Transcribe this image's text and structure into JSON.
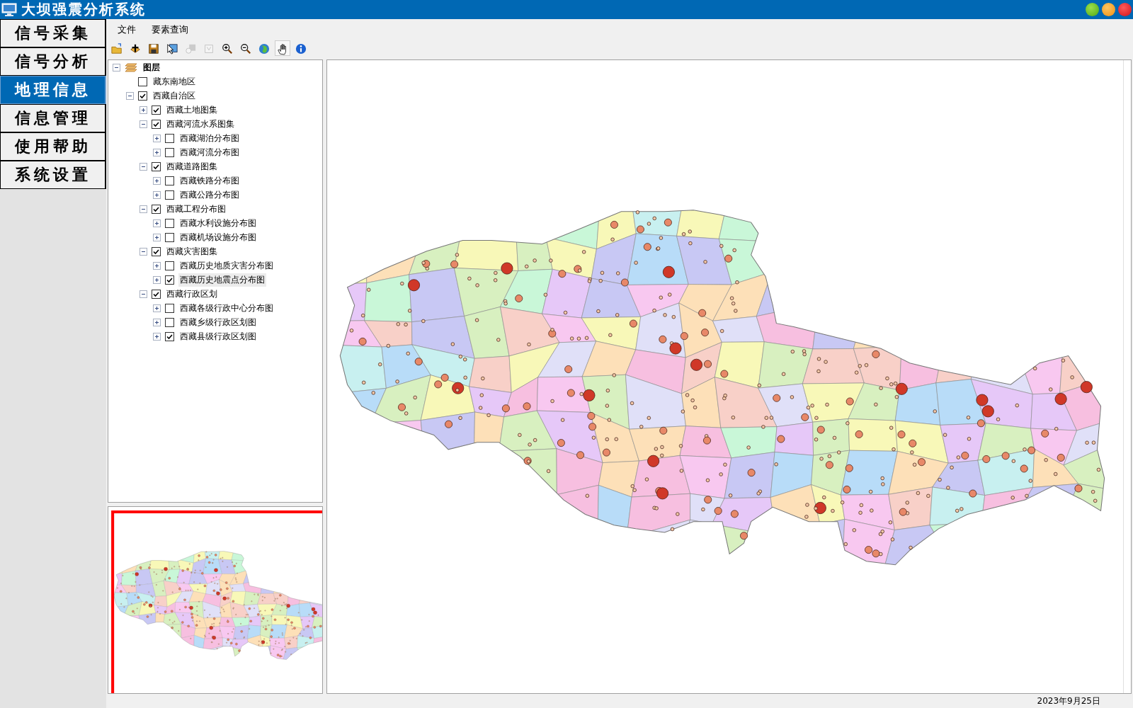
{
  "window": {
    "title": "大坝强震分析系统"
  },
  "nav": [
    {
      "label": "信号采集",
      "selected": false
    },
    {
      "label": "信号分析",
      "selected": false
    },
    {
      "label": "地理信息",
      "selected": true
    },
    {
      "label": "信息管理",
      "selected": false
    },
    {
      "label": "使用帮助",
      "selected": false
    },
    {
      "label": "系统设置",
      "selected": false
    }
  ],
  "menu": [
    "文件",
    "要素查询"
  ],
  "toolbar": [
    {
      "kind": "open",
      "disabled": false,
      "selected": false
    },
    {
      "kind": "add",
      "disabled": false,
      "selected": false
    },
    {
      "kind": "save",
      "disabled": false,
      "selected": false
    },
    {
      "kind": "select",
      "disabled": false,
      "selected": false
    },
    {
      "kind": "zoom-layer",
      "disabled": true,
      "selected": false
    },
    {
      "kind": "clear",
      "disabled": true,
      "selected": false
    },
    {
      "kind": "zoom-in",
      "disabled": false,
      "selected": false
    },
    {
      "kind": "zoom-out",
      "disabled": false,
      "selected": false
    },
    {
      "kind": "full-extent",
      "disabled": false,
      "selected": false
    },
    {
      "kind": "pan",
      "disabled": false,
      "selected": true
    },
    {
      "kind": "info",
      "disabled": false,
      "selected": false
    }
  ],
  "layers": {
    "label": "图层",
    "expanded": true,
    "children": [
      {
        "kind": "plain",
        "label": "藏东南地区",
        "checked": false,
        "selected": false
      },
      {
        "kind": "group",
        "label": "西藏自治区",
        "checked": true,
        "expanded": true,
        "selected": false,
        "children": [
          {
            "kind": "group",
            "label": "西藏土地图集",
            "checked": true,
            "expanded": false,
            "selected": false
          },
          {
            "kind": "group",
            "label": "西藏河流水系图集",
            "checked": true,
            "expanded": true,
            "selected": false,
            "children": [
              {
                "kind": "group",
                "label": "西藏湖泊分布图",
                "checked": false,
                "expanded": false,
                "selected": false
              },
              {
                "kind": "group",
                "label": "西藏河流分布图",
                "checked": false,
                "expanded": false,
                "selected": false
              }
            ]
          },
          {
            "kind": "group",
            "label": "西藏道路图集",
            "checked": true,
            "expanded": true,
            "selected": false,
            "children": [
              {
                "kind": "group",
                "label": "西藏铁路分布图",
                "checked": false,
                "expanded": false,
                "selected": false
              },
              {
                "kind": "group",
                "label": "西藏公路分布图",
                "checked": false,
                "expanded": false,
                "selected": false
              }
            ]
          },
          {
            "kind": "group",
            "label": "西藏工程分布图",
            "checked": true,
            "expanded": true,
            "selected": false,
            "children": [
              {
                "kind": "group",
                "label": "西藏水利设施分布图",
                "checked": false,
                "expanded": false,
                "selected": false
              },
              {
                "kind": "group",
                "label": "西藏机场设施分布图",
                "checked": false,
                "expanded": false,
                "selected": false
              }
            ]
          },
          {
            "kind": "group",
            "label": "西藏灾害图集",
            "checked": true,
            "expanded": true,
            "selected": false,
            "children": [
              {
                "kind": "group",
                "label": "西藏历史地质灾害分布图",
                "checked": false,
                "expanded": false,
                "selected": false
              },
              {
                "kind": "group",
                "label": "西藏历史地震点分布图",
                "checked": true,
                "expanded": false,
                "selected": true
              }
            ]
          },
          {
            "kind": "group",
            "label": "西藏行政区划",
            "checked": true,
            "expanded": true,
            "selected": false,
            "children": [
              {
                "kind": "group",
                "label": "西藏各级行政中心分布图",
                "checked": false,
                "expanded": false,
                "selected": false
              },
              {
                "kind": "group",
                "label": "西藏乡级行政区划图",
                "checked": false,
                "expanded": false,
                "selected": false
              },
              {
                "kind": "group",
                "label": "西藏县级行政区划图",
                "checked": true,
                "expanded": false,
                "selected": false
              }
            ]
          }
        ]
      }
    ]
  },
  "status_bar": {
    "date": "2023年9月25日"
  }
}
